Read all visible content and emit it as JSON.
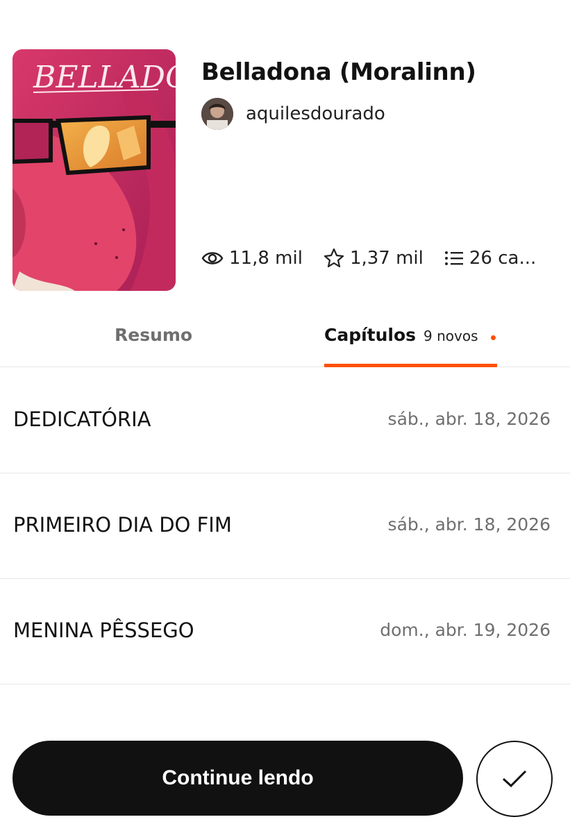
{
  "story": {
    "title": "Belladona (Moralinn)",
    "author": "aquilesdourado",
    "cover_title": "BELLADONA"
  },
  "stats": {
    "reads": "11,8 mil",
    "votes": "1,37 mil",
    "chapters": "26 ca..."
  },
  "tabs": {
    "summary": "Resumo",
    "chapters": "Capítulos",
    "new_badge": "9 novos"
  },
  "chapters": [
    {
      "title": "DEDICATÓRIA",
      "date": "sáb., abr. 18, 2026"
    },
    {
      "title": "PRIMEIRO DIA DO FIM",
      "date": "sáb., abr. 18, 2026"
    },
    {
      "title": "MENINA PÊSSEGO",
      "date": "dom., abr. 19, 2026"
    }
  ],
  "actions": {
    "continue_label": "Continue lendo"
  },
  "icons": {
    "reads": "eye-icon",
    "votes": "star-icon",
    "chapters": "list-icon",
    "done": "checkmark-icon"
  },
  "colors": {
    "accent": "#ff5000",
    "primary_button": "#111111",
    "muted_text": "#6f6f6f"
  }
}
